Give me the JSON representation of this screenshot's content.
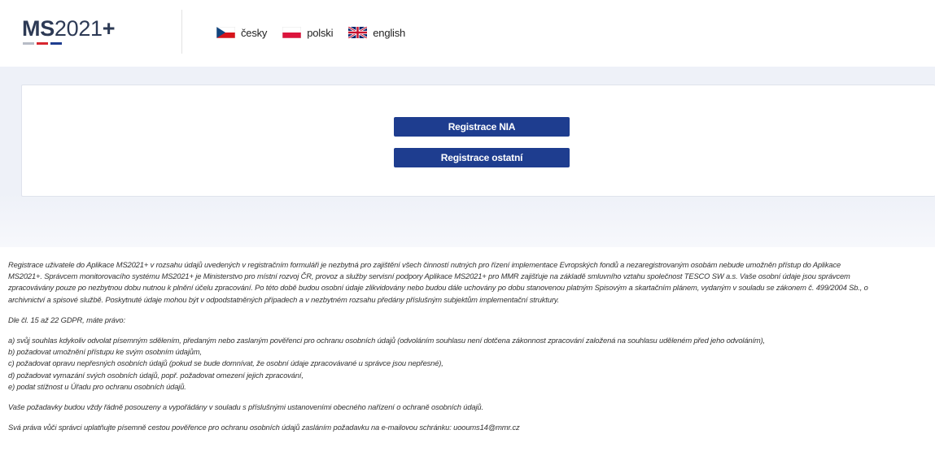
{
  "header": {
    "logo": {
      "part1": "MS",
      "part2": "2021",
      "part3": "+",
      "colors": {
        "text": "#2d3a55",
        "bar_grey": "#b7bcc6",
        "bar_red": "#d7262f",
        "bar_blue": "#1e3d8f"
      }
    },
    "languages": [
      {
        "label": "česky",
        "icon": "flag-cz-icon"
      },
      {
        "label": "polski",
        "icon": "flag-pl-icon"
      },
      {
        "label": "english",
        "icon": "flag-uk-icon"
      }
    ]
  },
  "registration": {
    "nia_button": "Registrace NIA",
    "other_button": "Registrace ostatní",
    "button_color": "#1e3d8f"
  },
  "info": {
    "paragraph1": [
      "Registrace uživatele do Aplikace MS2021+ v rozsahu údajů uvedených v registračním formuláři je nezbytná pro zajištění všech činností nutných pro řízení implementace Evropských fondů a nezaregistrovaným osobám nebude umožněn přístup do Aplikace",
      "MS2021+. Správcem monitorovacího systému MS2021+ je Ministerstvo pro místní rozvoj ČR, provoz a služby servisní podpory Aplikace MS2021+ pro MMR zajišťuje na základě smluvního vztahu společnost TESCO SW a.s. Vaše osobní údaje jsou správcem",
      "zpracovávány pouze po nezbytnou dobu nutnou k plnění účelu zpracování. Po této době budou osobní údaje zlikvidovány nebo budou dále uchovány po dobu stanovenou platným Spisovým a skartačním plánem, vydaným v souladu se zákonem č. 499/2004 Sb., o",
      "archivnictví a spisové službě. Poskytnuté údaje mohou být v odpodstatněných případech a v nezbytném rozsahu předány příslušným subjektům implementační struktury."
    ],
    "rights_intro": "Dle čl. 15 až 22 GDPR, máte právo:",
    "rights": [
      "a) svůj souhlas kdykoliv odvolat písemným sdělením, předaným nebo zaslaným pověřenci pro ochranu osobních údajů (odvoláním souhlasu není dotčena zákonnost zpracování založená na souhlasu uděleném před jeho odvoláním),",
      "b) požadovat umožnění přístupu ke svým osobním údajům,",
      "c) požadovat opravu nepřesných osobních údajů (pokud se bude domnívat, že osobní údaje zpracovávané u správce jsou nepřesné),",
      "d) požadovat vymazání svých osobních údajů, popř. požadovat omezení jejich zpracování,",
      "e) podat stížnost u Úřadu pro ochranu osobních údajů."
    ],
    "requests_note": "Vaše požadavky budou vždy řádně posouzeny a vypořádány v souladu s příslušnými ustanoveními obecného nařízení o ochraně osobních údajů.",
    "contact_note": "Svá práva vůči správci uplatňujte písemně cestou pověřence pro ochranu osobních údajů zasláním požadavku na e-mailovou schránku: uooums14@mmr.cz"
  }
}
